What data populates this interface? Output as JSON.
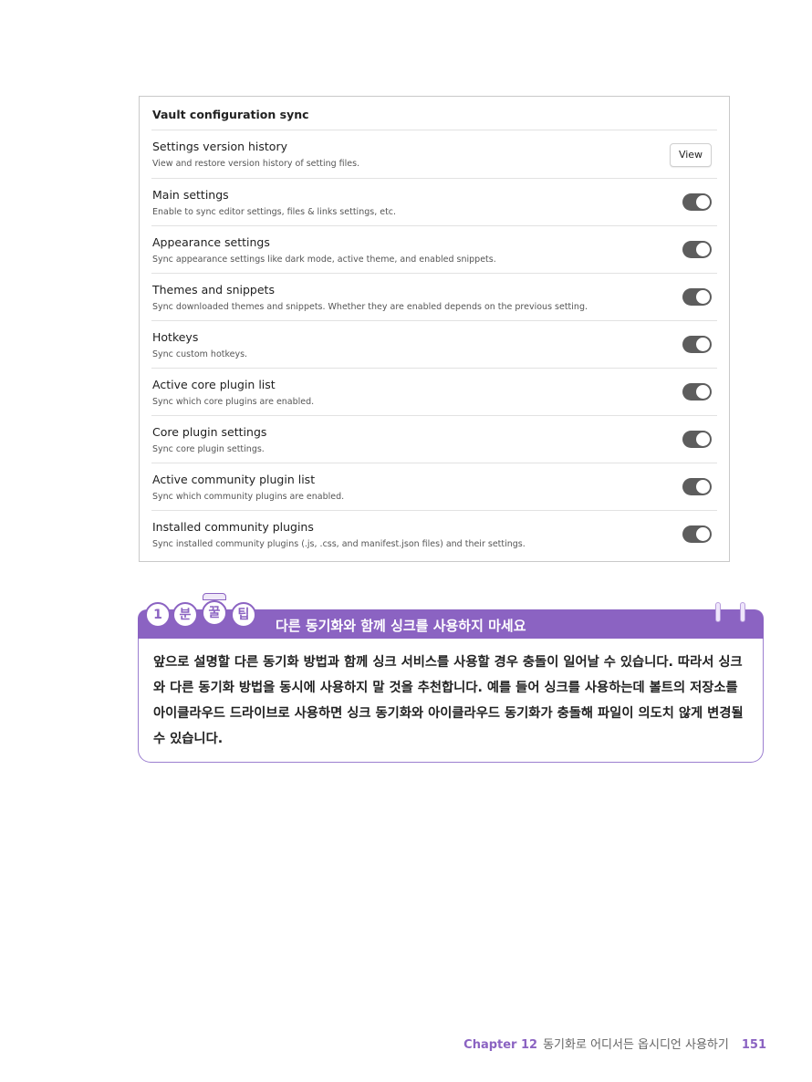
{
  "panel": {
    "title": "Vault configuration sync",
    "rows": [
      {
        "title": "Settings version history",
        "desc": "View and restore version history of setting files.",
        "control": "button",
        "button_label": "View"
      },
      {
        "title": "Main settings",
        "desc": "Enable to sync editor settings, files & links settings, etc.",
        "control": "toggle",
        "on": true
      },
      {
        "title": "Appearance settings",
        "desc": "Sync appearance settings like dark mode, active theme, and enabled snippets.",
        "control": "toggle",
        "on": true
      },
      {
        "title": "Themes and snippets",
        "desc": "Sync downloaded themes and snippets. Whether they are enabled depends on the previous setting.",
        "control": "toggle",
        "on": true
      },
      {
        "title": "Hotkeys",
        "desc": "Sync custom hotkeys.",
        "control": "toggle",
        "on": true
      },
      {
        "title": "Active core plugin list",
        "desc": "Sync which core plugins are enabled.",
        "control": "toggle",
        "on": true
      },
      {
        "title": "Core plugin settings",
        "desc": "Sync core plugin settings.",
        "control": "toggle",
        "on": true
      },
      {
        "title": "Active community plugin list",
        "desc": "Sync which community plugins are enabled.",
        "control": "toggle",
        "on": true
      },
      {
        "title": "Installed community plugins",
        "desc": "Sync installed community plugins (.js, .css, and manifest.json files) and their settings.",
        "control": "toggle",
        "on": true
      }
    ]
  },
  "tip": {
    "badges": [
      "1",
      "분",
      "꿀",
      "팁"
    ],
    "heading": "다른 동기화와 함께 싱크를 사용하지 마세요",
    "body": "앞으로 설명할 다른 동기화 방법과 함께 싱크 서비스를 사용할 경우 충돌이 일어날 수 있습니다. 따라서 싱크와 다른 동기화 방법을 동시에 사용하지 말 것을 추천합니다. 예를 들어 싱크를 사용하는데 볼트의 저장소를 아이클라우드 드라이브로 사용하면 싱크 동기화와 아이클라우드 동기화가 충돌해 파일이 의도치 않게 변경될 수 있습니다."
  },
  "footer": {
    "chapter": "Chapter 12",
    "chapter_title": "동기화로 어디서든 옵시디언 사용하기",
    "page": "151"
  },
  "colors": {
    "accent": "#8b63c2",
    "toggle_on": "#5d5d5d",
    "border": "#c9c9c9"
  }
}
